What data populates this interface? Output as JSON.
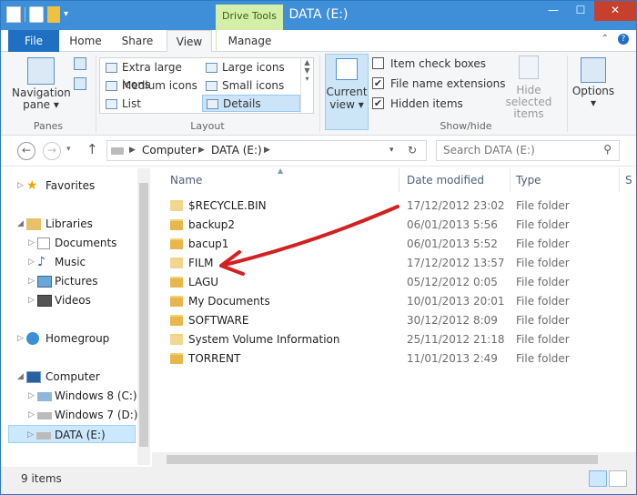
{
  "window": {
    "title": "DATA (E:)",
    "context_tab": "Drive Tools"
  },
  "window_buttons": [
    "—",
    "☐",
    "✕"
  ],
  "tabs": [
    {
      "label": "File"
    },
    {
      "label": "Home"
    },
    {
      "label": "Share"
    },
    {
      "label": "View"
    },
    {
      "label": "Manage"
    }
  ],
  "ribbon": {
    "panes": {
      "nav_pane_label": "Navigation",
      "nav_pane_label2": "pane ▾",
      "group": "Panes"
    },
    "layout": {
      "items": [
        "Extra large icons",
        "Large icons",
        "Medium icons",
        "Small icons",
        "List",
        "Details"
      ],
      "group": "Layout"
    },
    "current_view": {
      "label": "Current",
      "label2": "view ▾"
    },
    "show_hide": {
      "item_check_boxes": "Item check boxes",
      "file_name_extensions": "File name extensions",
      "hidden_items": "Hidden items",
      "hide_selected": "Hide selected",
      "hide_selected2": "items",
      "group": "Show/hide"
    },
    "options": {
      "label": "Options",
      "label2": "▾"
    }
  },
  "checkboxes": {
    "item_check_boxes": false,
    "file_name_extensions": true,
    "hidden_items": true
  },
  "address": {
    "computer": "Computer",
    "drive": "DATA (E:)",
    "search_placeholder": "Search DATA (E:)"
  },
  "nav_pane": {
    "favorites": "Favorites",
    "libraries": "Libraries",
    "documents": "Documents",
    "music": "Music",
    "pictures": "Pictures",
    "videos": "Videos",
    "homegroup": "Homegroup",
    "computer": "Computer",
    "win8": "Windows 8 (C:)",
    "win7": "Windows 7 (D:)",
    "data": "DATA (E:)"
  },
  "columns": {
    "name": "Name",
    "date": "Date modified",
    "type": "Type",
    "size": "S"
  },
  "files": [
    {
      "name": "$RECYCLE.BIN",
      "date": "17/12/2012 23:02",
      "type": "File folder"
    },
    {
      "name": "backup2",
      "date": "06/01/2013 5:56",
      "type": "File folder"
    },
    {
      "name": "bacup1",
      "date": "06/01/2013 5:52",
      "type": "File folder"
    },
    {
      "name": "FILM",
      "date": "17/12/2012 13:57",
      "type": "File folder"
    },
    {
      "name": "LAGU",
      "date": "05/12/2012 0:05",
      "type": "File folder"
    },
    {
      "name": "My Documents",
      "date": "10/01/2013 20:01",
      "type": "File folder"
    },
    {
      "name": "SOFTWARE",
      "date": "30/12/2012 8:09",
      "type": "File folder"
    },
    {
      "name": "System Volume Information",
      "date": "25/11/2012 21:18",
      "type": "File folder"
    },
    {
      "name": "TORRENT",
      "date": "11/01/2013 2:49",
      "type": "File folder"
    }
  ],
  "status": {
    "count": "9 items"
  },
  "colors": {
    "accent": "#1f6fc3",
    "titlebar": "#3e8ed8",
    "annotation": "#d42020"
  }
}
